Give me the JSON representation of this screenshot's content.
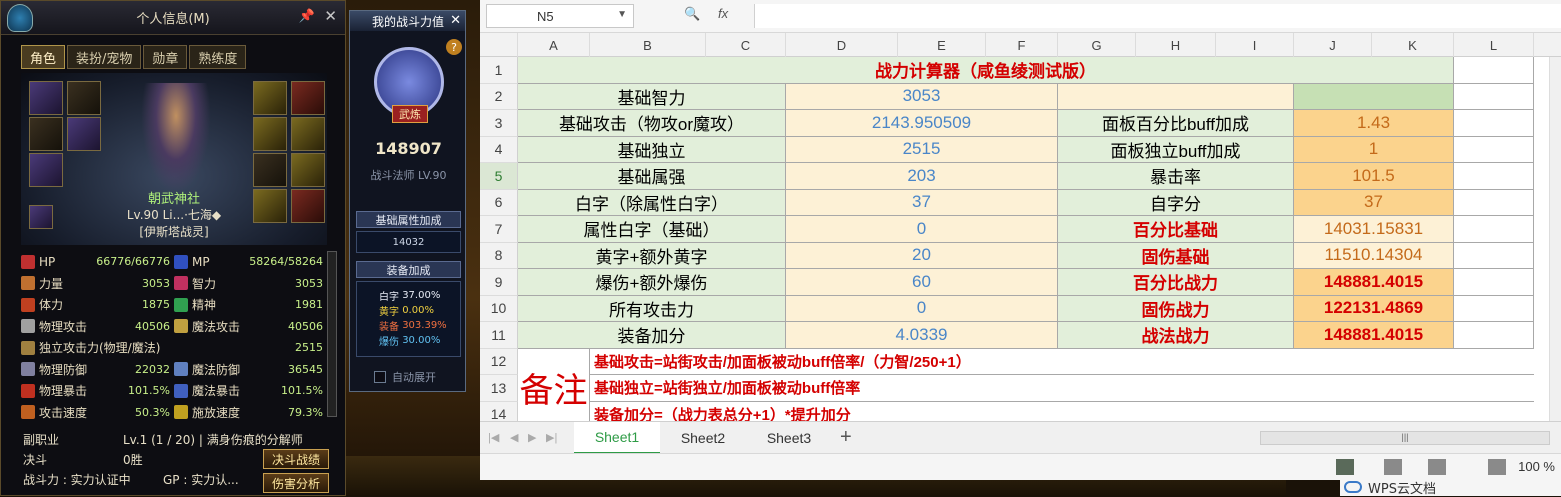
{
  "game": {
    "char_panel": {
      "title": "个人信息(M)",
      "tabs": [
        "角色",
        "装扮/宠物",
        "勋章",
        "熟练度"
      ],
      "active_tab": "角色",
      "name": "朝武神社",
      "level_line": "Lv.90 Li...·七海◆",
      "guild": "[伊斯塔战灵]",
      "stats": [
        [
          {
            "label": "HP",
            "value": "66776/66776",
            "color": "#c03030"
          },
          {
            "label": "MP",
            "value": "58264/58264",
            "color": "#3050c0"
          }
        ],
        [
          {
            "label": "力量",
            "value": "3053",
            "color": "#c07030"
          },
          {
            "label": "智力",
            "value": "3053",
            "color": "#c03060"
          }
        ],
        [
          {
            "label": "体力",
            "value": "1875",
            "color": "#c04020"
          },
          {
            "label": "精神",
            "value": "1981",
            "color": "#30a050"
          }
        ],
        [
          {
            "label": "物理攻击",
            "value": "40506",
            "color": "#a0a0a0"
          },
          {
            "label": "魔法攻击",
            "value": "40506",
            "color": "#c0a040"
          }
        ],
        [
          {
            "label": "独立攻击力(物理/魔法)",
            "value": "2515",
            "color": "#a08040"
          }
        ],
        [
          {
            "label": "物理防御",
            "value": "22032",
            "color": "#8080a0"
          },
          {
            "label": "魔法防御",
            "value": "36545",
            "color": "#6080c0"
          }
        ],
        [
          {
            "label": "物理暴击",
            "value": "101.5%",
            "color": "#c03020"
          },
          {
            "label": "魔法暴击",
            "value": "101.5%",
            "color": "#4060c0"
          }
        ],
        [
          {
            "label": "攻击速度",
            "value": "50.3%",
            "color": "#c06020"
          },
          {
            "label": "施放速度",
            "value": "79.3%",
            "color": "#c0a020"
          }
        ]
      ],
      "subjob_label": "副职业",
      "subjob_value": "Lv.1 (1 / 20) | 满身伤痕的分解师",
      "duel_label": "决斗",
      "duel_value": "0胜",
      "power_line": "战斗力 : 实力认证中",
      "gp_line": "GP : 实力认...",
      "btn_duel": "决斗战绩",
      "btn_damage": "伤害分析"
    },
    "cp_panel": {
      "title": "我的战斗力值",
      "help": "?",
      "badge": "武炼",
      "value": "148907",
      "class_line": "战斗法师 LV.90",
      "base_section": "基础属性加成",
      "base_value": "14032",
      "equip_section": "装备加成",
      "equip_rows": [
        {
          "label": "白字",
          "value": "37.00%",
          "color": "#e8ecf6"
        },
        {
          "label": "黄字",
          "value": "0.00%",
          "color": "#f0d040"
        },
        {
          "label": "装备",
          "value": "303.39%",
          "color": "#f07040"
        },
        {
          "label": "爆伤",
          "value": "30.00%",
          "color": "#60c0f0"
        }
      ],
      "auto_expand": "自动展开"
    }
  },
  "spreadsheet": {
    "namebox": "N5",
    "fx_label": "fx",
    "columns": [
      "A",
      "B",
      "C",
      "D",
      "E",
      "F",
      "G",
      "H",
      "I",
      "J",
      "K",
      "L"
    ],
    "rows": [
      "1",
      "2",
      "3",
      "4",
      "5",
      "6",
      "7",
      "8",
      "9",
      "10",
      "11",
      "12",
      "13",
      "14"
    ],
    "selected_row": "5",
    "title": "战力计算器（咸鱼绫测试版）",
    "left_labels": [
      "基础智力",
      "基础攻击（物攻or魔攻）",
      "基础独立",
      "基础属强",
      "白字（除属性白字）",
      "属性白字（基础）",
      "黄字+额外黄字",
      "爆伤+额外爆伤",
      "所有攻击力",
      "装备加分"
    ],
    "left_values": [
      "3053",
      "2143.950509",
      "2515",
      "203",
      "37",
      "0",
      "20",
      "60",
      "0",
      "4.0339"
    ],
    "right_labels": [
      "",
      "面板百分比buff加成",
      "面板独立buff加成",
      "暴击率",
      "自字分",
      "百分比基础",
      "固伤基础",
      "百分比战力",
      "固伤战力",
      "战法战力"
    ],
    "right_values": [
      "",
      "1.43",
      "1",
      "101.5",
      "37",
      "14031.15831",
      "11510.14304",
      "148881.4015",
      "122131.4869",
      "148881.4015"
    ],
    "remark_label": "备注",
    "remarks": [
      "基础攻击=站街攻击/加面板被动buff倍率/（力智/250+1）",
      "基础独立=站街独立/加面板被动buff倍率",
      "装备加分=（战力表总分+1）*提升加分"
    ],
    "sheet_tabs": [
      "Sheet1",
      "Sheet2",
      "Sheet3"
    ],
    "active_sheet": "Sheet1",
    "zoom": "100 %",
    "cloud_label": "WPS云文档"
  }
}
